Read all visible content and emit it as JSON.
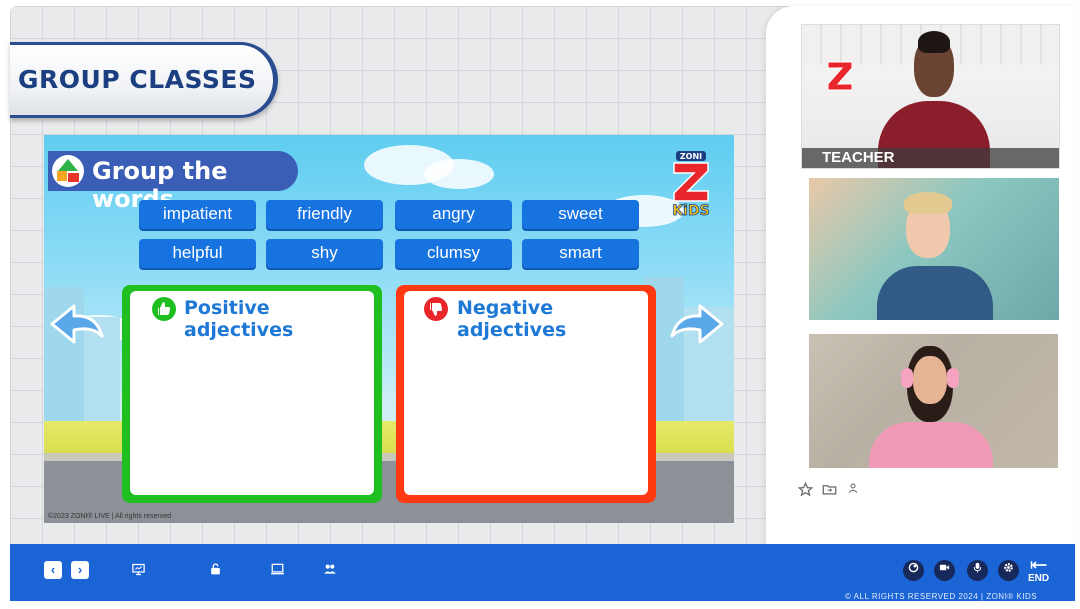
{
  "banner": {
    "title": "GROUP CLASSES"
  },
  "slide": {
    "title": "Group the words",
    "logo": {
      "top": "ZONI",
      "bottom": "KiDS"
    },
    "words": [
      "impatient",
      "friendly",
      "angry",
      "sweet",
      "helpful",
      "shy",
      "clumsy",
      "smart"
    ],
    "positive_label": "Positive adjectives",
    "negative_label": "Negative adjectives",
    "copyright": "©2023 ZONI® LIVE | All rights reserved"
  },
  "video": {
    "teacher_label": "TEACHER"
  },
  "tile_actions": {
    "star": "star-icon",
    "folder": "folder-move-icon",
    "user": "user-icon"
  },
  "footer": {
    "text": "© ALL RIGHTS RESERVED 2024 | ZONI® KIDS",
    "end_label": "END"
  },
  "colors": {
    "bar": "#1a64d6",
    "positive": "#1fbf1f",
    "negative": "#ff3a12",
    "chip": "#1773e0"
  }
}
